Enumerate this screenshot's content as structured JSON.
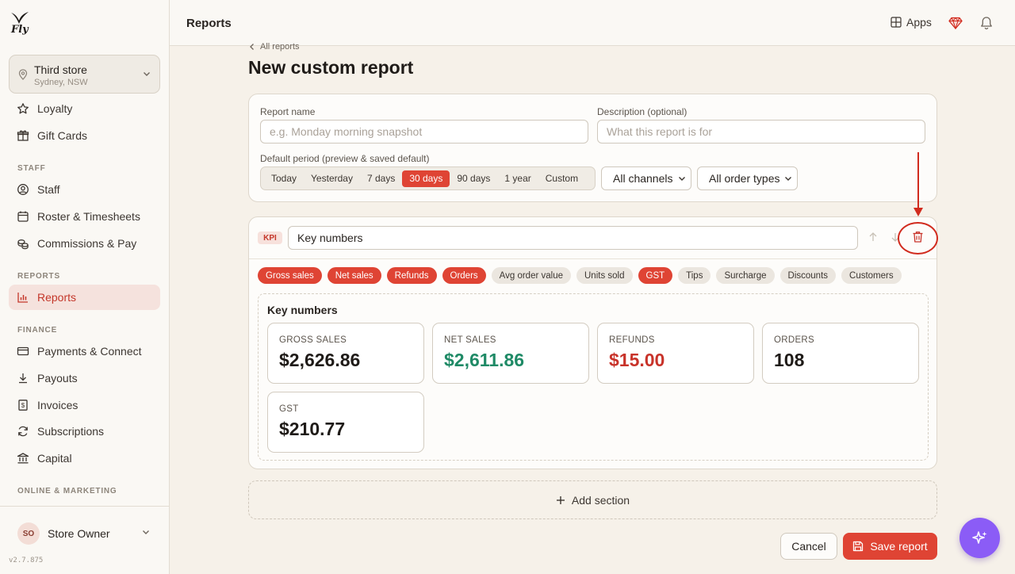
{
  "brand": {
    "logo_text": "Fly",
    "accent": "#df4434",
    "version": "v2.7.875"
  },
  "store": {
    "name": "Third store",
    "location": "Sydney, NSW"
  },
  "sidebar": {
    "items": [
      {
        "label": "Loyalty",
        "icon": "star-icon"
      },
      {
        "label": "Gift Cards",
        "icon": "gift-icon"
      },
      {
        "label": "Staff",
        "icon": "user-circle-icon"
      },
      {
        "label": "Roster & Timesheets",
        "icon": "calendar-icon"
      },
      {
        "label": "Commissions & Pay",
        "icon": "coins-icon"
      },
      {
        "label": "Reports",
        "icon": "bar-chart-icon",
        "active": true
      },
      {
        "label": "Payments & Connect",
        "icon": "credit-card-icon"
      },
      {
        "label": "Payouts",
        "icon": "download-icon"
      },
      {
        "label": "Invoices",
        "icon": "invoice-icon"
      },
      {
        "label": "Subscriptions",
        "icon": "refresh-icon"
      },
      {
        "label": "Capital",
        "icon": "bank-icon"
      }
    ],
    "sections": [
      "STAFF",
      "REPORTS",
      "FINANCE",
      "ONLINE & MARKETING"
    ],
    "user": {
      "initials": "SO",
      "name": "Store Owner"
    }
  },
  "topbar": {
    "title": "Reports",
    "apps_label": "Apps"
  },
  "breadcrumb": "All reports",
  "page_title": "New custom report",
  "form": {
    "report_name_label": "Report name",
    "report_name_placeholder": "e.g. Monday morning snapshot",
    "description_label": "Description (optional)",
    "description_placeholder": "What this report is for",
    "period_label": "Default period (preview & saved default)",
    "periods": [
      "Today",
      "Yesterday",
      "7 days",
      "30 days",
      "90 days",
      "1 year",
      "Custom"
    ],
    "active_period": "30 days",
    "channels": "All channels",
    "order_types": "All order types"
  },
  "section": {
    "badge": "KPI",
    "name": "Key numbers",
    "metrics": [
      {
        "label": "Gross sales",
        "on": true
      },
      {
        "label": "Net sales",
        "on": true
      },
      {
        "label": "Refunds",
        "on": true
      },
      {
        "label": "Orders",
        "on": true
      },
      {
        "label": "Avg order value",
        "on": false
      },
      {
        "label": "Units sold",
        "on": false
      },
      {
        "label": "GST",
        "on": true
      },
      {
        "label": "Tips",
        "on": false
      },
      {
        "label": "Surcharge",
        "on": false
      },
      {
        "label": "Discounts",
        "on": false
      },
      {
        "label": "Customers",
        "on": false
      }
    ],
    "preview_title": "Key numbers",
    "kpis": [
      {
        "label": "GROSS SALES",
        "value": "$2,626.86",
        "color": "#1f1b18"
      },
      {
        "label": "NET SALES",
        "value": "$2,611.86",
        "color": "#1f8a66"
      },
      {
        "label": "REFUNDS",
        "value": "$15.00",
        "color": "#c8332a"
      },
      {
        "label": "ORDERS",
        "value": "108",
        "color": "#1f1b18"
      },
      {
        "label": "GST",
        "value": "$210.77",
        "color": "#1f1b18"
      }
    ]
  },
  "actions": {
    "add_section": "Add section",
    "cancel": "Cancel",
    "save": "Save report"
  }
}
